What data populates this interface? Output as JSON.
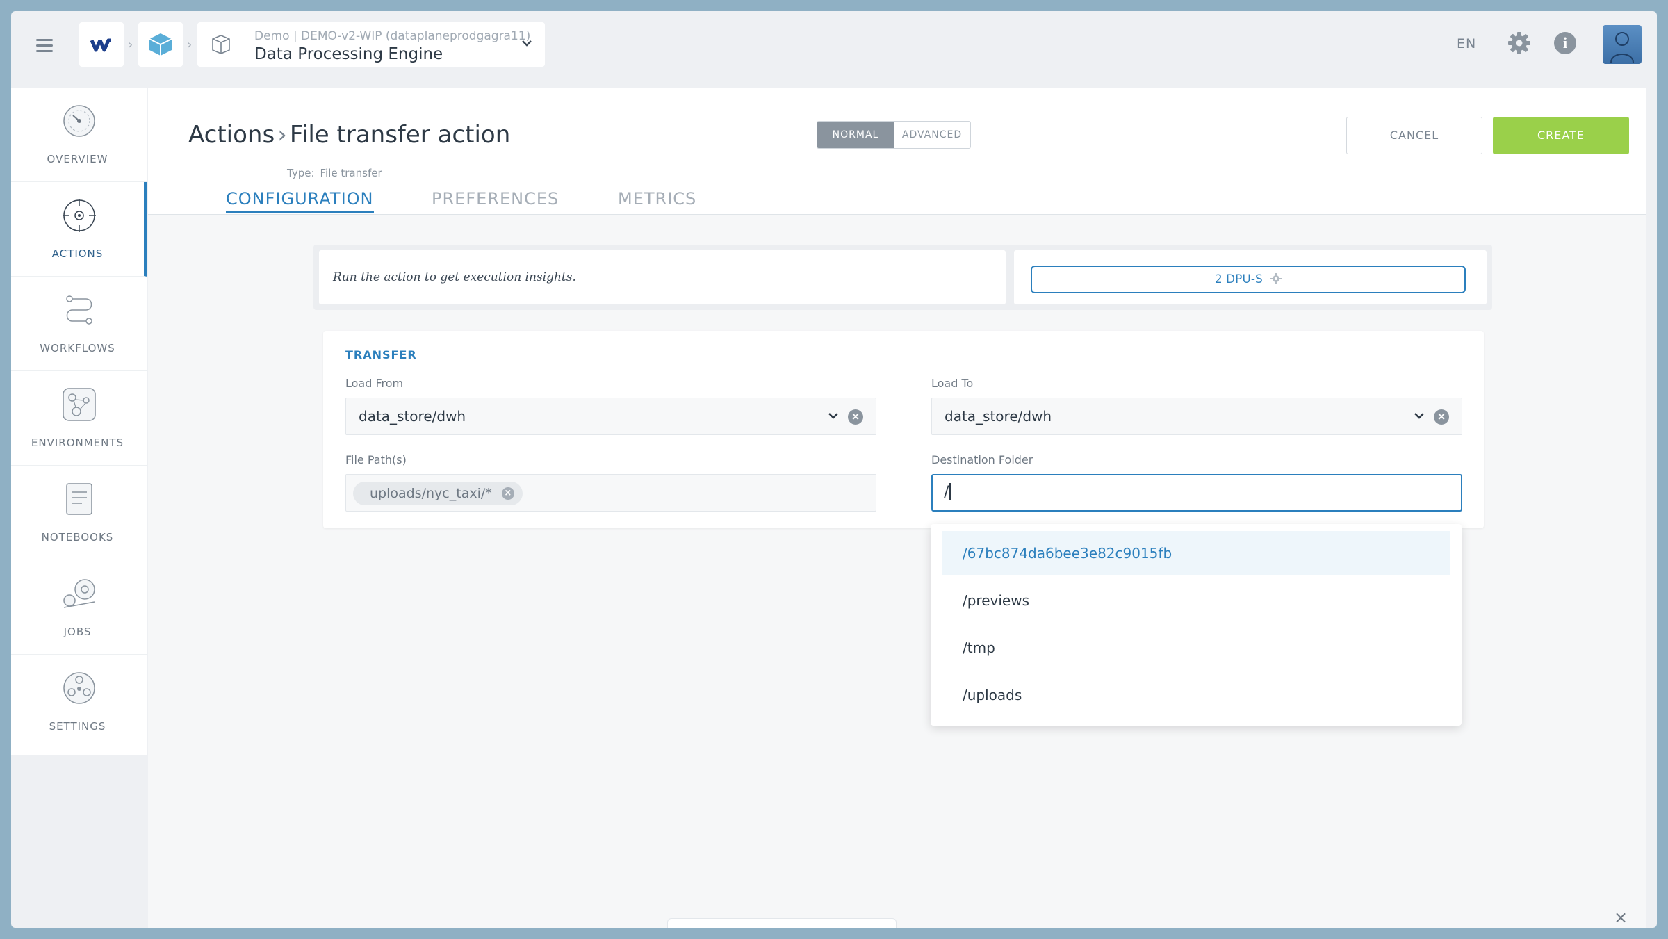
{
  "topbar": {
    "project_sub": "Demo | DEMO-v2-WIP (dataplaneprodgagra11)",
    "project_title": "Data Processing Engine",
    "language": "EN"
  },
  "sidebar": {
    "items": [
      {
        "label": "OVERVIEW",
        "icon": "overview-icon"
      },
      {
        "label": "ACTIONS",
        "icon": "actions-icon",
        "active": true
      },
      {
        "label": "WORKFLOWS",
        "icon": "workflows-icon"
      },
      {
        "label": "ENVIRONMENTS",
        "icon": "environments-icon"
      },
      {
        "label": "NOTEBOOKS",
        "icon": "notebooks-icon"
      },
      {
        "label": "JOBS",
        "icon": "jobs-icon"
      },
      {
        "label": "SETTINGS",
        "icon": "settings-icon"
      }
    ]
  },
  "header": {
    "breadcrumb_root": "Actions",
    "breadcrumb_current": "File transfer action",
    "type_label": "Type:",
    "type_value": "File transfer",
    "mode_normal": "NORMAL",
    "mode_advanced": "ADVANCED",
    "cancel_label": "CANCEL",
    "create_label": "CREATE"
  },
  "tabs": [
    {
      "label": "CONFIGURATION",
      "active": true
    },
    {
      "label": "PREFERENCES"
    },
    {
      "label": "METRICS"
    }
  ],
  "insights": {
    "text": "Run the action to get execution insights.",
    "dpu_label": "2 DPU-S"
  },
  "transfer": {
    "title": "TRANSFER",
    "load_from_label": "Load From",
    "load_from_value": "data_store/dwh",
    "load_to_label": "Load To",
    "load_to_value": "data_store/dwh",
    "file_paths_label": "File Path(s)",
    "file_path_chip": "uploads/nyc_taxi/*",
    "destination_label": "Destination Folder",
    "destination_value": "/"
  },
  "dropdown": {
    "options": [
      "/67bc874da6bee3e82c9015fb",
      "/previews",
      "/tmp",
      "/uploads"
    ],
    "highlighted": 0
  },
  "colors": {
    "accent": "#2b7fbd",
    "create": "#9ad04a",
    "frame": "#8fb0c4"
  }
}
